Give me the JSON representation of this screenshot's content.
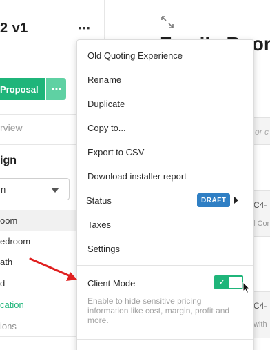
{
  "left": {
    "project_title": "2  v1",
    "more_label": "⋯",
    "proposal_label": "Proposal",
    "proposal_more": "⋯",
    "tab_overview": "rview",
    "section_heading": "ign",
    "select_value": "n",
    "rooms": [
      {
        "label": "oom",
        "state": "selected"
      },
      {
        "label": "edroom",
        "state": "normal"
      },
      {
        "label": "ath",
        "state": "normal"
      },
      {
        "label": "d",
        "state": "normal"
      },
      {
        "label": "cation",
        "state": "accent"
      },
      {
        "label": "ions",
        "state": "muted"
      }
    ]
  },
  "background": {
    "title": "Family Room",
    "rows": [
      {
        "text": "or c",
        "sub": ""
      },
      {
        "text": "C4-",
        "sub": "l Cor"
      },
      {
        "text": "C4-",
        "sub": "with"
      }
    ]
  },
  "menu": {
    "items": [
      {
        "label": "Old Quoting Experience"
      },
      {
        "label": "Rename"
      },
      {
        "label": "Duplicate"
      },
      {
        "label": "Copy to..."
      },
      {
        "label": "Export to CSV"
      },
      {
        "label": "Download installer report"
      },
      {
        "label": "Status",
        "badge": "DRAFT"
      },
      {
        "label": "Taxes"
      },
      {
        "label": "Settings"
      }
    ],
    "client_mode": {
      "label": "Client Mode",
      "enabled": true,
      "check": "✓",
      "description": "Enable to hide sensitive pricing information like cost, margin, profit and more."
    }
  },
  "colors": {
    "accent_green": "#1fb57a",
    "badge_blue": "#2f7fc4",
    "annotation_red": "#e02020"
  },
  "icons": [
    "expand-icon",
    "kebab-menu-icon",
    "caret-down-icon",
    "caret-right-icon",
    "checkmark-icon",
    "mouse-cursor-icon",
    "annotation-arrow"
  ]
}
